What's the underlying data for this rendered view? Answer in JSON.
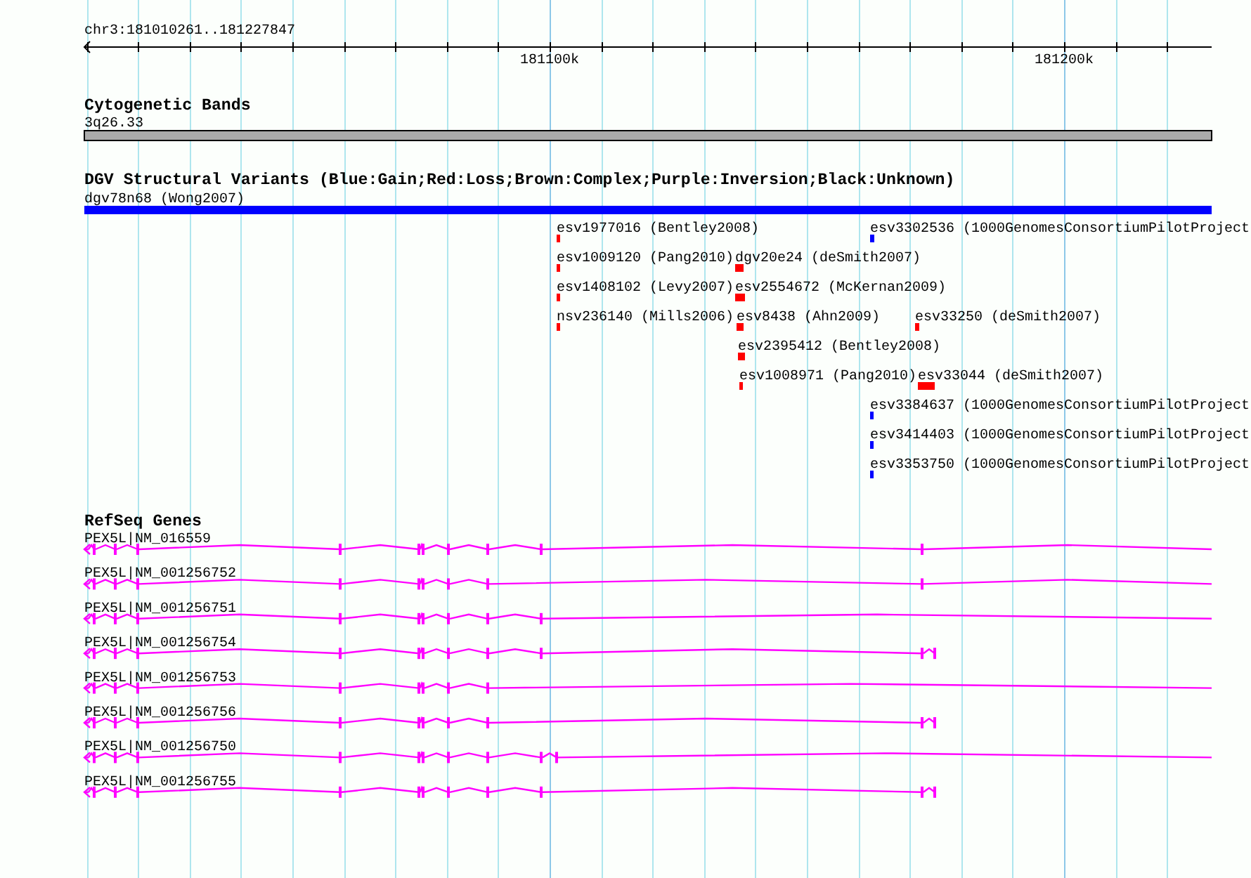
{
  "ruler": {
    "label": "chr3:181010261..181227847",
    "major_ticks": [
      {
        "label": "181100k"
      },
      {
        "label": "181200k"
      }
    ]
  },
  "cytoband_track": {
    "title": "Cytogenetic Bands",
    "band": {
      "label": "3q26.33"
    }
  },
  "dgv_track": {
    "title": "DGV Structural Variants (Blue:Gain;Red:Loss;Brown:Complex;Purple:Inversion;Black:Unknown)",
    "banner": {
      "label": "dgv78n68 (Wong2007)",
      "color": "#0000ff"
    },
    "rows": [
      [
        {
          "label": "esv1977016 (Bentley2008)",
          "color": "#ff0000"
        },
        {
          "label": "esv3302536 (1000GenomesConsortiumPilotProject",
          "color": "#0000ff"
        }
      ],
      [
        {
          "label": "esv1009120 (Pang2010)",
          "color": "#ff0000"
        },
        {
          "label": "dgv20e24 (deSmith2007)",
          "color": "#ff0000"
        }
      ],
      [
        {
          "label": "esv1408102 (Levy2007)",
          "color": "#ff0000"
        },
        {
          "label": "esv2554672 (McKernan2009)",
          "color": "#ff0000"
        }
      ],
      [
        {
          "label": "nsv236140 (Mills2006)",
          "color": "#ff0000"
        },
        {
          "label": "esv8438 (Ahn2009)",
          "color": "#ff0000"
        },
        {
          "label": "esv33250 (deSmith2007)",
          "color": "#ff0000"
        }
      ],
      [
        {
          "label": "esv2395412 (Bentley2008)",
          "color": "#ff0000"
        }
      ],
      [
        {
          "label": "esv1008971 (Pang2010)",
          "color": "#ff0000"
        },
        {
          "label": "esv33044 (deSmith2007)",
          "color": "#ff0000"
        }
      ],
      [
        {
          "label": "esv3384637 (1000GenomesConsortiumPilotProject",
          "color": "#0000ff"
        }
      ],
      [
        {
          "label": "esv3414403 (1000GenomesConsortiumPilotProject",
          "color": "#0000ff"
        }
      ],
      [
        {
          "label": "esv3353750 (1000GenomesConsortiumPilotProject",
          "color": "#0000ff"
        }
      ]
    ]
  },
  "refseq_track": {
    "title": "RefSeq Genes",
    "transcripts": [
      {
        "label": "PEX5L|NM_016559"
      },
      {
        "label": "PEX5L|NM_001256752"
      },
      {
        "label": "PEX5L|NM_001256751"
      },
      {
        "label": "PEX5L|NM_001256754"
      },
      {
        "label": "PEX5L|NM_001256753"
      },
      {
        "label": "PEX5L|NM_001256756"
      },
      {
        "label": "PEX5L|NM_001256750"
      },
      {
        "label": "PEX5L|NM_001256755"
      }
    ]
  }
}
